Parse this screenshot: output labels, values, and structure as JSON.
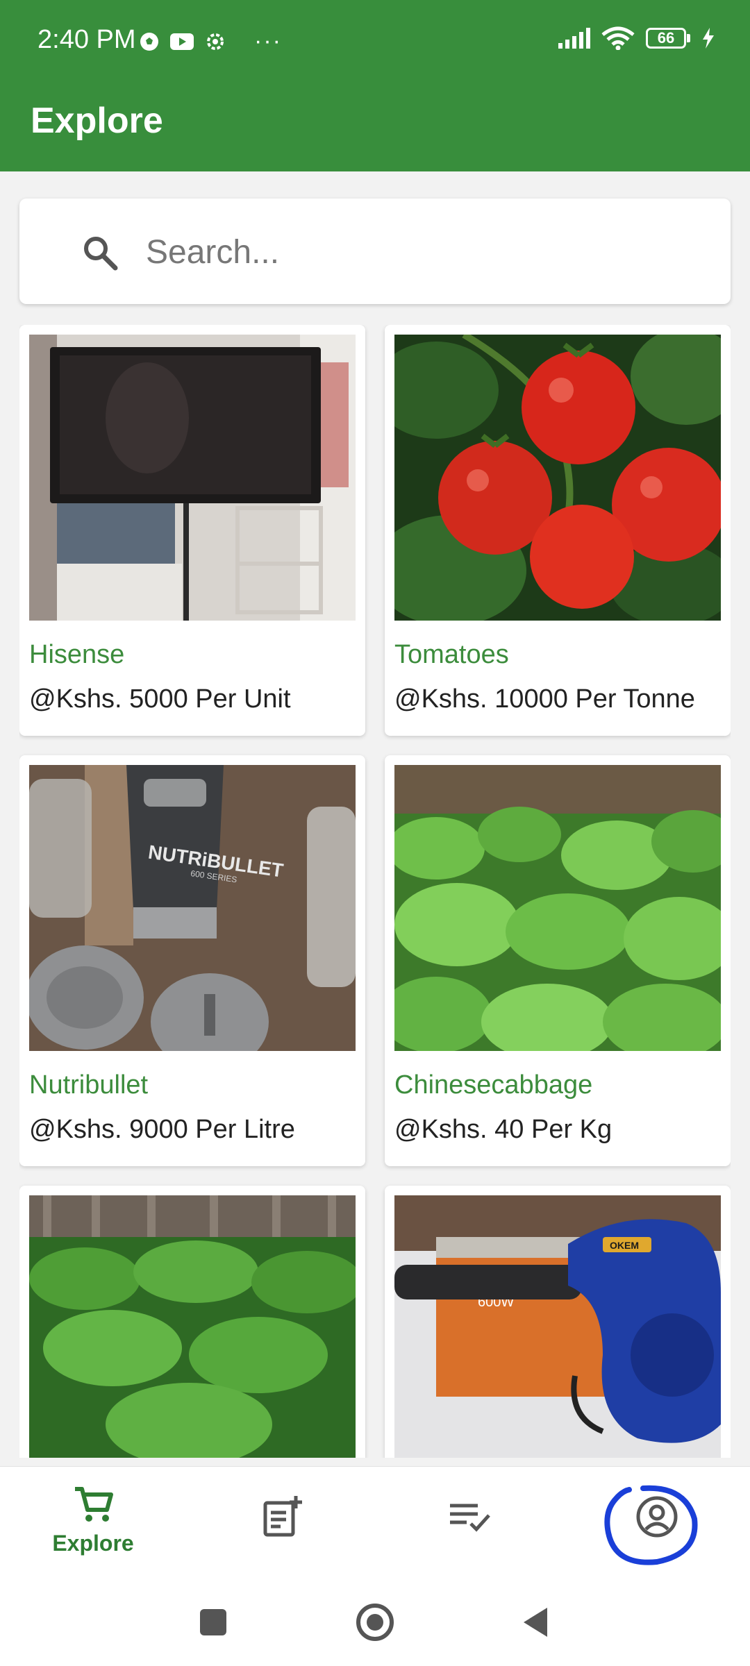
{
  "status_bar": {
    "time": "2:40 PM",
    "overflow": "···",
    "battery": "66"
  },
  "app_bar": {
    "title": "Explore"
  },
  "search": {
    "placeholder": "Search..."
  },
  "products": [
    {
      "name": "Hisense",
      "price": "@Kshs. 5000 Per Unit",
      "image": "tv-on-stand"
    },
    {
      "name": "Tomatoes",
      "price": "@Kshs. 10000 Per Tonne",
      "image": "tomatoes"
    },
    {
      "name": "Nutribullet",
      "price": "@Kshs. 9000 Per Litre",
      "image": "nutribullet-blender"
    },
    {
      "name": "Chinesecabbage",
      "price": "@Kshs. 40 Per Kg",
      "image": "cabbage-field"
    },
    {
      "name": "",
      "price": "",
      "image": "leafy-greens"
    },
    {
      "name": "",
      "price": "",
      "image": "blower-device"
    }
  ],
  "image_text": {
    "nutribullet_brand": "NUTRiBULLET",
    "nutribullet_series": "600 SERIES",
    "blower_power": "600W",
    "blower_brand": "OKEM"
  },
  "bottom_nav": {
    "explore_label": "Explore",
    "active_color": "#2e7d32",
    "inactive_color": "#555555"
  },
  "colors": {
    "primary": "#388e3c",
    "accent_text": "#3c8c3c",
    "annotation": "#1a3fd8"
  }
}
